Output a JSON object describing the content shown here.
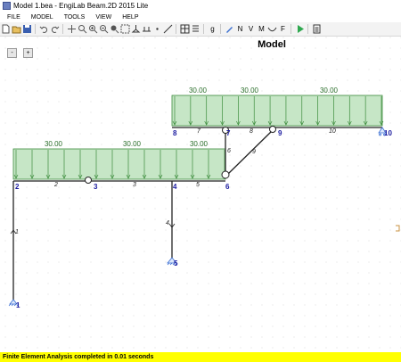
{
  "window": {
    "title": "Model 1.bea - EngiLab Beam.2D 2015 Lite"
  },
  "menu": [
    {
      "key": "file",
      "label": "FILE"
    },
    {
      "key": "model",
      "label": "MODEL"
    },
    {
      "key": "tools",
      "label": "TOOLS"
    },
    {
      "key": "view",
      "label": "VIEW"
    },
    {
      "key": "help",
      "label": "HELP"
    }
  ],
  "toolbar": {
    "letters": {
      "n": "N",
      "v": "V",
      "m": "M",
      "f": "F",
      "g": "g"
    }
  },
  "zoom": {
    "out": "-",
    "in": "+"
  },
  "canvas": {
    "title": "Model",
    "loads": [
      {
        "label": "30.00"
      },
      {
        "label": "30.00"
      },
      {
        "label": "30.00"
      },
      {
        "label": "30.00"
      },
      {
        "label": "30.00"
      },
      {
        "label": "30.00"
      }
    ],
    "nodes": [
      {
        "label": "1"
      },
      {
        "label": "2"
      },
      {
        "label": "3"
      },
      {
        "label": "4"
      },
      {
        "label": "5"
      },
      {
        "label": "6"
      },
      {
        "label": "7"
      },
      {
        "label": "8"
      },
      {
        "label": "9"
      },
      {
        "label": "10"
      }
    ],
    "elements": [
      {
        "label": "1"
      },
      {
        "label": "2"
      },
      {
        "label": "3"
      },
      {
        "label": "4"
      },
      {
        "label": "5"
      },
      {
        "label": "6"
      },
      {
        "label": "7"
      },
      {
        "label": "8"
      },
      {
        "label": "9"
      },
      {
        "label": "10"
      }
    ],
    "colors": {
      "load_fill": "#c6e6c6",
      "load_stroke": "#3c8c3c",
      "node_label": "#1c1ca0",
      "support": "#3b6fd4"
    }
  },
  "status": {
    "message": "Finite Element Analysis completed in 0.01 seconds"
  }
}
